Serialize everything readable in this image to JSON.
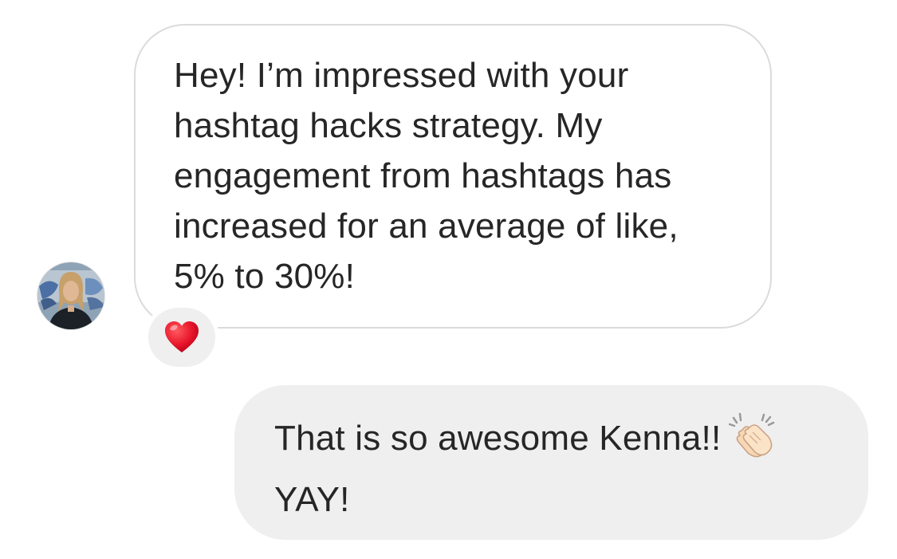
{
  "conversation": {
    "incoming": {
      "avatar": "avatar-photo-icon",
      "lines": [
        "Hey! I’m impressed with your",
        "hashtag hacks strategy. My",
        "engagement from hashtags has",
        "increased for an average of like,",
        "5% to 30%!"
      ],
      "reaction": "heart-reaction-icon"
    },
    "outgoing": {
      "lines": [
        "That is so awesome Kenna!!",
        "YAY!"
      ],
      "emoji": "clapping-hands-icon"
    }
  },
  "colors": {
    "incoming_border": "#dbdbdb",
    "outgoing_background": "#efefef",
    "text": "#262626",
    "heart": "#e8162b"
  }
}
